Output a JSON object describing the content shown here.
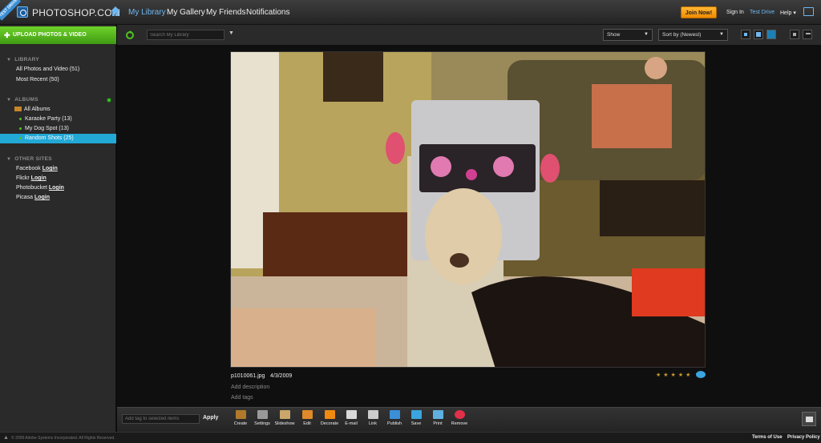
{
  "brand": {
    "ribbon": "TEST DRIVE",
    "logo_text": "PHOTOSHOP.COM"
  },
  "topnav": {
    "items": [
      {
        "label": "My Library",
        "active": true
      },
      {
        "label": "My Gallery",
        "active": false
      },
      {
        "label": "My Friends",
        "active": false
      },
      {
        "label": "Notifications",
        "active": false
      }
    ],
    "join_label": "Join Now!",
    "sign_in": "Sign In",
    "test_drive": "Test Drive",
    "help": "Help ▾"
  },
  "sidebar": {
    "upload_label": "UPLOAD PHOTOS & VIDEO",
    "library_head": "LIBRARY",
    "library_items": [
      "All Photos and Video (51)",
      "Most Recent (50)"
    ],
    "albums_head": "ALBUMS",
    "all_albums": "All Albums",
    "albums": [
      {
        "label": "Karaoke Party (13)",
        "selected": false
      },
      {
        "label": "My Dog Spot (13)",
        "selected": false
      },
      {
        "label": "Random Shots (25)",
        "selected": true
      }
    ],
    "other_head": "OTHER SITES",
    "sites": [
      {
        "name": "Facebook",
        "login": "Login"
      },
      {
        "name": "Flickr",
        "login": "Login"
      },
      {
        "name": "Photobucket",
        "login": "Login"
      },
      {
        "name": "Picasa",
        "login": "Login"
      }
    ]
  },
  "toolbar": {
    "search_placeholder": "Search My Library",
    "show_label": "Show",
    "sort_label": "Sort by (Newest)"
  },
  "photo": {
    "filename": "p1010061.jpg",
    "date": "4/3/2009",
    "add_description": "Add description",
    "add_tags": "Add tags",
    "rating_stars": "★★★★★"
  },
  "actionbar": {
    "tag_placeholder": "Add tag to selected items",
    "apply_label": "Apply",
    "actions": [
      {
        "label": "Create",
        "icon": "create-icon",
        "color": "#b07a2a"
      },
      {
        "label": "Settings",
        "icon": "settings-icon",
        "color": "#9a9a9a"
      },
      {
        "label": "Slideshow",
        "icon": "slideshow-icon",
        "color": "#c9a66b"
      },
      {
        "label": "Edit",
        "icon": "edit-icon",
        "color": "#e08a2a"
      },
      {
        "label": "Decorate",
        "icon": "decorate-icon",
        "color": "#f08a10"
      },
      {
        "label": "E-mail",
        "icon": "email-icon",
        "color": "#d8d8d8"
      },
      {
        "label": "Link",
        "icon": "link-icon",
        "color": "#cccccc"
      },
      {
        "label": "Publish",
        "icon": "publish-icon",
        "color": "#3a8fd6"
      },
      {
        "label": "Save",
        "icon": "save-icon",
        "color": "#3aa5de"
      },
      {
        "label": "Print",
        "icon": "print-icon",
        "color": "#5fb0e0"
      },
      {
        "label": "Remove",
        "icon": "remove-icon",
        "color": "#e0304a"
      }
    ]
  },
  "footer": {
    "copyright": "© 2009 Adobe Systems Incorporated. All Rights Reserved.",
    "terms": "Terms of Use",
    "privacy": "Privacy Policy"
  }
}
